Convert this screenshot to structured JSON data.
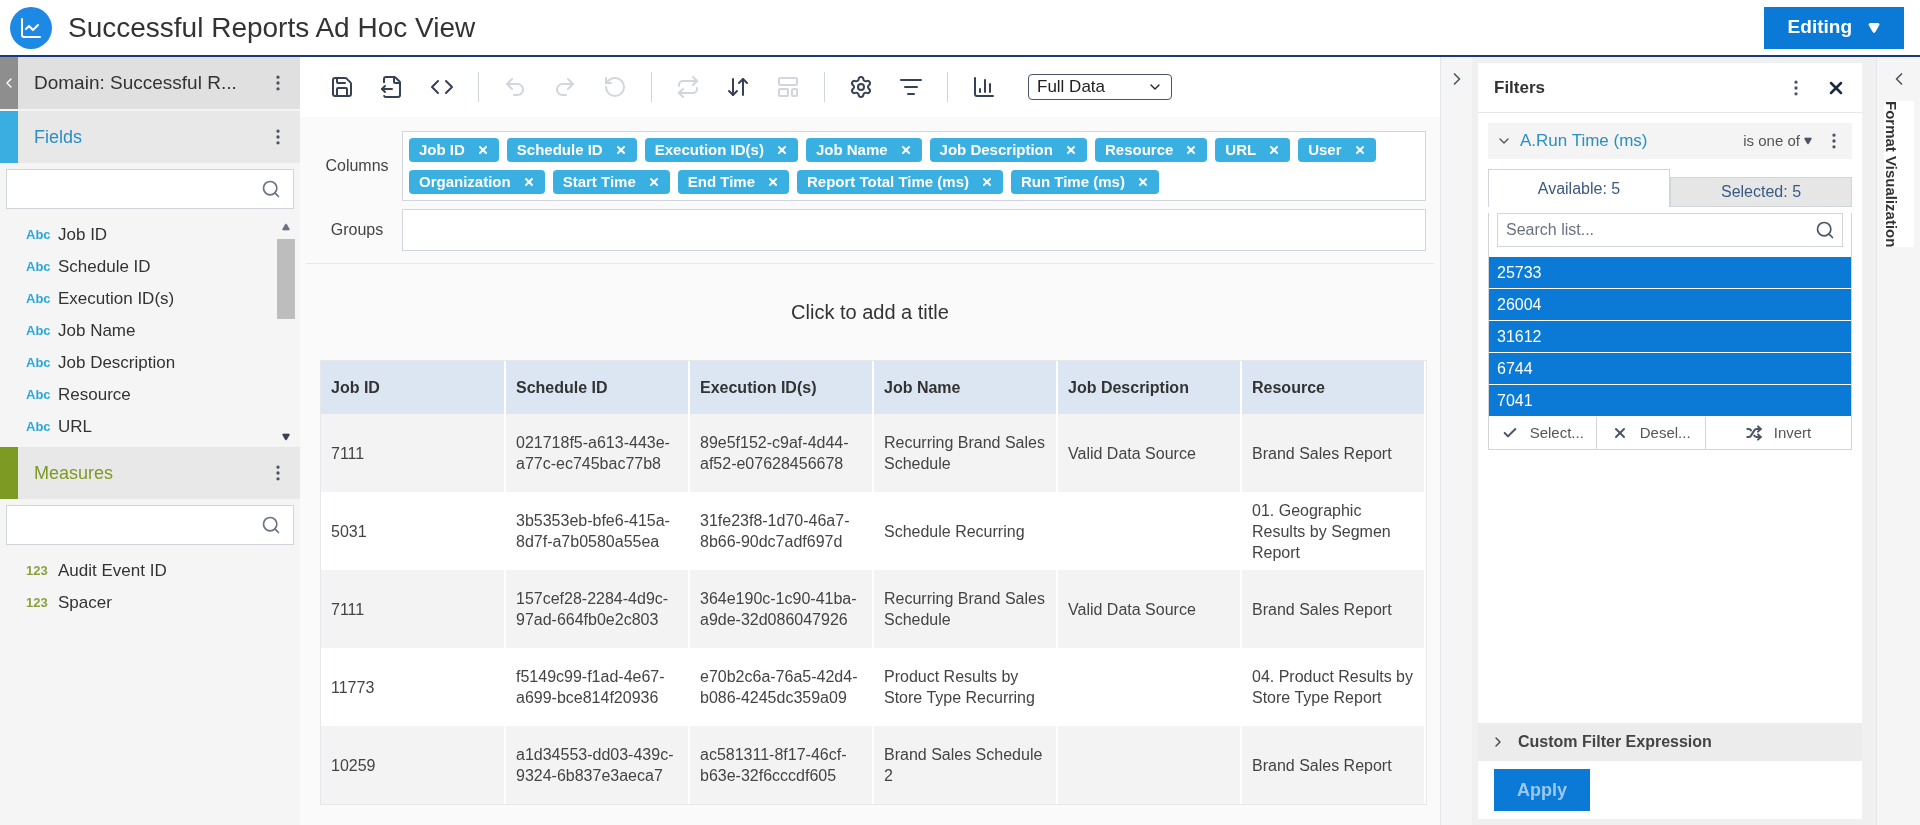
{
  "header": {
    "title": "Successful Reports Ad Hoc View",
    "mode_button": "Editing"
  },
  "sidebar": {
    "domain": "Domain: Successful R...",
    "fields": {
      "title": "Fields",
      "items": [
        {
          "type_label": "Abc",
          "name": "Job ID"
        },
        {
          "type_label": "Abc",
          "name": "Schedule ID"
        },
        {
          "type_label": "Abc",
          "name": "Execution ID(s)"
        },
        {
          "type_label": "Abc",
          "name": "Job Name"
        },
        {
          "type_label": "Abc",
          "name": "Job Description"
        },
        {
          "type_label": "Abc",
          "name": "Resource"
        },
        {
          "type_label": "Abc",
          "name": "URL"
        }
      ]
    },
    "measures": {
      "title": "Measures",
      "items": [
        {
          "type_label": "123",
          "name": "Audit Event ID"
        },
        {
          "type_label": "123",
          "name": "Spacer"
        }
      ]
    }
  },
  "toolbar": {
    "buttons": [
      {
        "disabled": false
      },
      {
        "disabled": false
      },
      {
        "disabled": false
      },
      {
        "disabled": true
      },
      {
        "disabled": true
      },
      {
        "disabled": true
      },
      {
        "disabled": true
      },
      {
        "disabled": false
      },
      {
        "disabled": true
      },
      {
        "disabled": false
      },
      {
        "disabled": false
      },
      {
        "disabled": false
      }
    ],
    "data_select": "Full Data"
  },
  "columns": {
    "label": "Columns",
    "chips": [
      "Job ID",
      "Schedule ID",
      "Execution ID(s)",
      "Job Name",
      "Job Description",
      "Resource",
      "URL",
      "User",
      "Organization",
      "Start Time",
      "End Time",
      "Report Total Time (ms)",
      "Run Time (ms)"
    ]
  },
  "groups": {
    "label": "Groups"
  },
  "report_title": "Click to add a title",
  "table": {
    "columns": [
      "Job ID",
      "Schedule ID",
      "Execution ID(s)",
      "Job Name",
      "Job Description",
      "Resource"
    ],
    "rows": [
      [
        "7111",
        "021718f5-a613-443e-a77c-ec745bac77b8",
        "89e5f152-c9af-4d44-af52-e07628456678",
        "Recurring Brand Sales Schedule",
        "Valid Data Source",
        "Brand Sales Report"
      ],
      [
        "5031",
        "3b5353eb-bfe6-415a-8d7f-a7b0580a55ea",
        "31fe23f8-1d70-46a7-8b66-90dc7adf697d",
        "Schedule Recurring",
        "",
        "01. Geographic Results by Segmen Report"
      ],
      [
        "7111",
        "157cef28-2284-4d9c-97ad-664fb0e2c803",
        "364e190c-1c90-41ba-a9de-32d086047926",
        "Recurring Brand Sales Schedule",
        "Valid Data Source",
        "Brand Sales Report"
      ],
      [
        "11773",
        "f5149c99-f1ad-4e67-a699-bce814f20936",
        "e70b2c6a-76a5-42d4-b086-4245dc359a09",
        "Product Results by Store Type Recurring",
        "",
        "04. Product Results by Store Type Report"
      ],
      [
        "10259",
        "a1d34553-dd03-439c-9324-6b837e3aeca7",
        "ac581311-8f17-46cf-b63e-32f6cccdf605",
        "Brand Sales Schedule 2",
        "",
        "Brand Sales Report"
      ]
    ]
  },
  "filters": {
    "title": "Filters",
    "filter": {
      "field": "A.Run Time (ms)",
      "operator": "is one of",
      "expanded": true,
      "tabs": [
        {
          "label": "Available: 5",
          "selected": true
        },
        {
          "label": "Selected: 5",
          "selected": false
        }
      ],
      "search_placeholder": "Search list...",
      "values": [
        {
          "label": "25733",
          "selected": true
        },
        {
          "label": "26004",
          "selected": true
        },
        {
          "label": "31612",
          "selected": true
        },
        {
          "label": "6744",
          "selected": true
        },
        {
          "label": "7041",
          "selected": true
        }
      ],
      "actions": [
        "Select...",
        "Desel...",
        "Invert"
      ]
    },
    "custom_expression": "Custom Filter Expression",
    "apply": "Apply"
  },
  "side_tab": "Format Visualization"
}
